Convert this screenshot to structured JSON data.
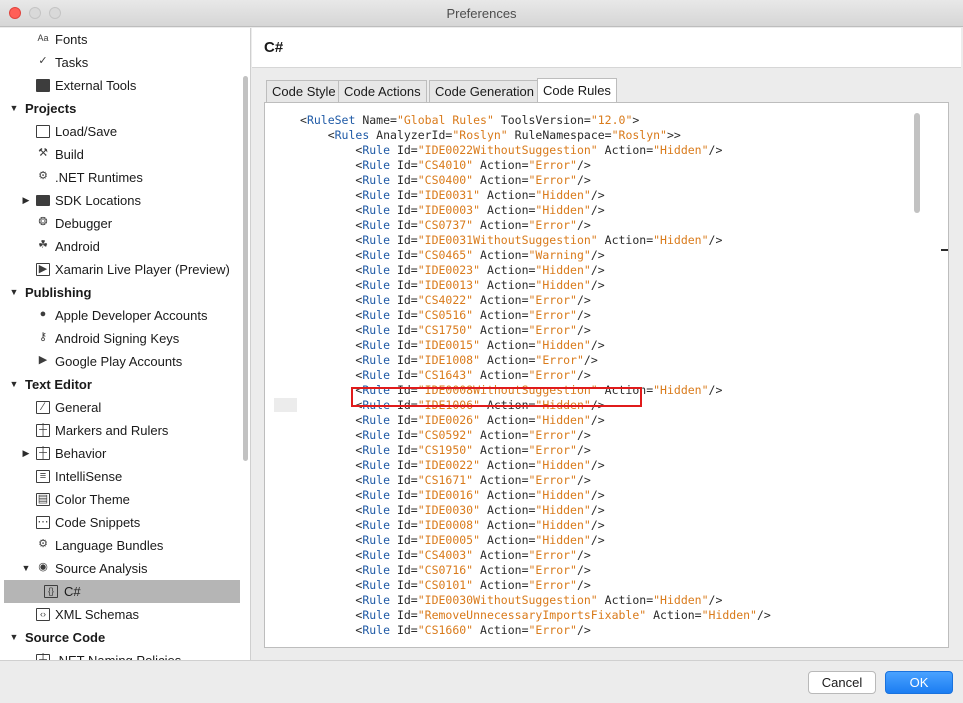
{
  "window": {
    "title": "Preferences"
  },
  "sidebar": {
    "items": [
      {
        "label": "Fonts",
        "icon": "font-size-icon",
        "kind": "child"
      },
      {
        "label": "Tasks",
        "icon": "checkmark-icon",
        "kind": "child"
      },
      {
        "label": "External Tools",
        "icon": "terminal-icon",
        "kind": "child"
      },
      {
        "label": "Projects",
        "kind": "category"
      },
      {
        "label": "Load/Save",
        "icon": "drive-icon",
        "kind": "child"
      },
      {
        "label": "Build",
        "icon": "hammer-icon",
        "kind": "child"
      },
      {
        "label": ".NET Runtimes",
        "icon": "gear-icon",
        "kind": "child"
      },
      {
        "label": "SDK Locations",
        "icon": "folder-icon",
        "kind": "child-expandable"
      },
      {
        "label": "Debugger",
        "icon": "bug-icon",
        "kind": "child"
      },
      {
        "label": "Android",
        "icon": "android-icon",
        "kind": "child"
      },
      {
        "label": "Xamarin Live Player (Preview)",
        "icon": "play-icon",
        "kind": "child"
      },
      {
        "label": "Publishing",
        "kind": "category"
      },
      {
        "label": "Apple Developer Accounts",
        "icon": "apple-icon",
        "kind": "child"
      },
      {
        "label": "Android Signing Keys",
        "icon": "key-icon",
        "kind": "child"
      },
      {
        "label": "Google Play Accounts",
        "icon": "google-play-icon",
        "kind": "child"
      },
      {
        "label": "Text Editor",
        "kind": "category"
      },
      {
        "label": "General",
        "icon": "edit-icon",
        "kind": "child"
      },
      {
        "label": "Markers and Rulers",
        "icon": "grid-icon",
        "kind": "child"
      },
      {
        "label": "Behavior",
        "icon": "grid-icon",
        "kind": "child-expandable"
      },
      {
        "label": "IntelliSense",
        "icon": "list-icon",
        "kind": "child"
      },
      {
        "label": "Color Theme",
        "icon": "palette-icon",
        "kind": "child"
      },
      {
        "label": "Code Snippets",
        "icon": "snippet-icon",
        "kind": "child"
      },
      {
        "label": "Language Bundles",
        "icon": "gear-icon",
        "kind": "child"
      },
      {
        "label": "Source Analysis",
        "icon": "radio-icon",
        "kind": "child-expanded"
      },
      {
        "label": "C#",
        "icon": "csharp-file-icon",
        "kind": "grandchild-selected"
      },
      {
        "label": "XML Schemas",
        "icon": "xml-icon",
        "kind": "child"
      },
      {
        "label": "Source Code",
        "kind": "category"
      },
      {
        "label": ".NET Naming Policies",
        "icon": "grid-icon",
        "kind": "child"
      }
    ]
  },
  "content": {
    "title": "C#",
    "tabs": [
      "Code Style",
      "Code Actions",
      "Code Generation",
      "Code Rules"
    ],
    "active_tab": "Code Rules",
    "code": {
      "ruleset_open": {
        "tag": "RuleSet",
        "name_attr": "Name",
        "name_val": "Global Rules",
        "tv_attr": "ToolsVersion",
        "tv_val": "12.0"
      },
      "rules_open": {
        "tag": "Rules",
        "a_attr": "AnalyzerId",
        "a_val": "Roslyn",
        "n_attr": "RuleNamespace",
        "n_val": "Roslyn"
      },
      "rules": [
        {
          "id": "IDE0022WithoutSuggestion",
          "action": "Hidden"
        },
        {
          "id": "CS4010",
          "action": "Error"
        },
        {
          "id": "CS0400",
          "action": "Error"
        },
        {
          "id": "IDE0031",
          "action": "Hidden"
        },
        {
          "id": "IDE0003",
          "action": "Hidden"
        },
        {
          "id": "CS0737",
          "action": "Error"
        },
        {
          "id": "IDE0031WithoutSuggestion",
          "action": "Hidden"
        },
        {
          "id": "CS0465",
          "action": "Warning"
        },
        {
          "id": "IDE0023",
          "action": "Hidden"
        },
        {
          "id": "IDE0013",
          "action": "Hidden"
        },
        {
          "id": "CS4022",
          "action": "Error"
        },
        {
          "id": "CS0516",
          "action": "Error"
        },
        {
          "id": "CS1750",
          "action": "Error"
        },
        {
          "id": "IDE0015",
          "action": "Hidden"
        },
        {
          "id": "IDE1008",
          "action": "Error"
        },
        {
          "id": "CS1643",
          "action": "Error"
        },
        {
          "id": "IDE0008WithoutSuggestion",
          "action": "Hidden"
        },
        {
          "id": "IDE1006",
          "action": "Hidden"
        },
        {
          "id": "IDE0026",
          "action": "Hidden"
        },
        {
          "id": "CS0592",
          "action": "Error"
        },
        {
          "id": "CS1950",
          "action": "Error"
        },
        {
          "id": "IDE0022",
          "action": "Hidden"
        },
        {
          "id": "CS1671",
          "action": "Error"
        },
        {
          "id": "IDE0016",
          "action": "Hidden"
        },
        {
          "id": "IDE0030",
          "action": "Hidden"
        },
        {
          "id": "IDE0008",
          "action": "Hidden"
        },
        {
          "id": "IDE0005",
          "action": "Hidden"
        },
        {
          "id": "CS4003",
          "action": "Error"
        },
        {
          "id": "CS0716",
          "action": "Error"
        },
        {
          "id": "CS0101",
          "action": "Error"
        },
        {
          "id": "IDE0030WithoutSuggestion",
          "action": "Hidden"
        },
        {
          "id": "RemoveUnnecessaryImportsFixable",
          "action": "Hidden"
        },
        {
          "id": "CS1660",
          "action": "Error"
        }
      ],
      "highlighted_rule_id": "IDE1006"
    }
  },
  "footer": {
    "cancel_label": "Cancel",
    "ok_label": "OK"
  },
  "colors": {
    "accent": "#1b7df2",
    "xml_tag": "#1f5aa6",
    "xml_value": "#d97a1a",
    "highlight": "#e01b1b"
  }
}
